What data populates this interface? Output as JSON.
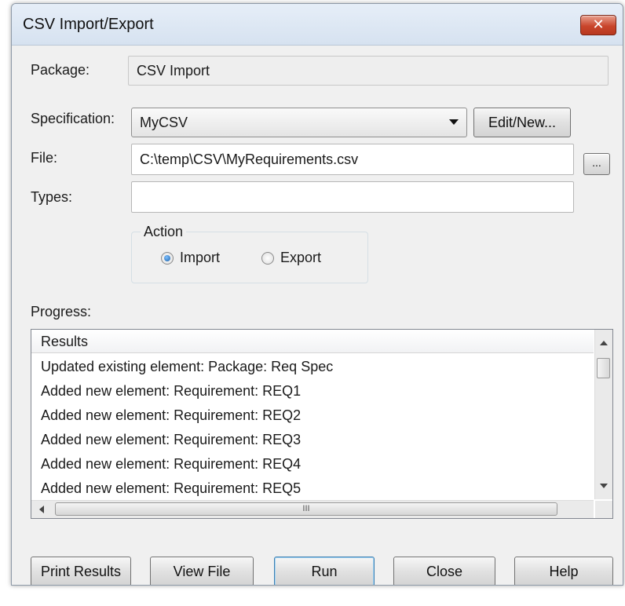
{
  "window": {
    "title": "CSV Import/Export",
    "close_glyph": "✕"
  },
  "package": {
    "label": "Package:",
    "value": "CSV Import"
  },
  "specification": {
    "label": "Specification:",
    "value": "MyCSV",
    "edit_button": "Edit/New..."
  },
  "file": {
    "label": "File:",
    "value": "C:\\temp\\CSV\\MyRequirements.csv",
    "browse_button": "..."
  },
  "types": {
    "label": "Types:",
    "value": ""
  },
  "action": {
    "caption": "Action",
    "import_label": "Import",
    "export_label": "Export",
    "selected": "Import"
  },
  "progress": {
    "label": "Progress:",
    "column_header": "Results",
    "rows": [
      "Updated existing element: Package: Req Spec",
      "Added new element: Requirement: REQ1",
      "Added new element: Requirement: REQ2",
      "Added new element: Requirement: REQ3",
      "Added new element: Requirement: REQ4",
      "Added new element: Requirement: REQ5"
    ],
    "scroll_grip": "III"
  },
  "buttons": {
    "print_results": "Print Results",
    "view_file": "View File",
    "run": "Run",
    "close": "Close",
    "help": "Help"
  }
}
